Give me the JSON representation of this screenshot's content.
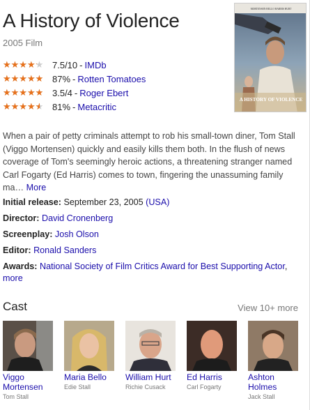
{
  "title": "A History of Violence",
  "subtitle": "2005 Film",
  "poster": {
    "alt": "A History of Violence poster",
    "top_names": [
      "MORTENSEN",
      "BELLO",
      "HARRIS",
      "HURT"
    ],
    "logo_text": "A HISTORY OF VIOLENCE"
  },
  "ratings": [
    {
      "value": "7.5/10",
      "source": "IMDb",
      "stars_fraction": 0.75
    },
    {
      "value": "87%",
      "source": "Rotten Tomatoes",
      "stars_fraction": 0.87
    },
    {
      "value": "3.5/4",
      "source": "Roger Ebert",
      "stars_fraction": 0.875
    },
    {
      "value": "81%",
      "source": "Metacritic",
      "stars_fraction": 0.81
    }
  ],
  "rating_separator": "-",
  "description": "When a pair of petty criminals attempt to rob his small-town diner, Tom Stall (Viggo Mortensen) quickly and easily kills them both. In the flush of news coverage of Tom's seemingly heroic actions, a threatening stranger named Carl Fogarty (Ed Harris) comes to town, fingering the unassuming family ma…",
  "description_more": "More",
  "facts": {
    "release_label": "Initial release:",
    "release_value": "September 23, 2005",
    "release_country": "(USA)",
    "director_label": "Director:",
    "director_value": "David Cronenberg",
    "screenplay_label": "Screenplay:",
    "screenplay_value": "Josh Olson",
    "editor_label": "Editor:",
    "editor_value": "Ronald Sanders",
    "awards_label": "Awards:",
    "awards_value": "National Society of Film Critics Award for Best Supporting Actor",
    "awards_more": "more"
  },
  "cast_heading": "Cast",
  "cast_more": "View 10+ more",
  "cast": [
    {
      "name": "Viggo Mortensen",
      "role": "Tom Stall"
    },
    {
      "name": "Maria Bello",
      "role": "Edie Stall"
    },
    {
      "name": "William Hurt",
      "role": "Richie Cusack"
    },
    {
      "name": "Ed Harris",
      "role": "Carl Fogarty"
    },
    {
      "name": "Ashton Holmes",
      "role": "Jack Stall"
    }
  ],
  "colors": {
    "link": "#1a0dab",
    "star": "#e7711b",
    "star_empty": "#cccccc",
    "muted": "#777777"
  }
}
